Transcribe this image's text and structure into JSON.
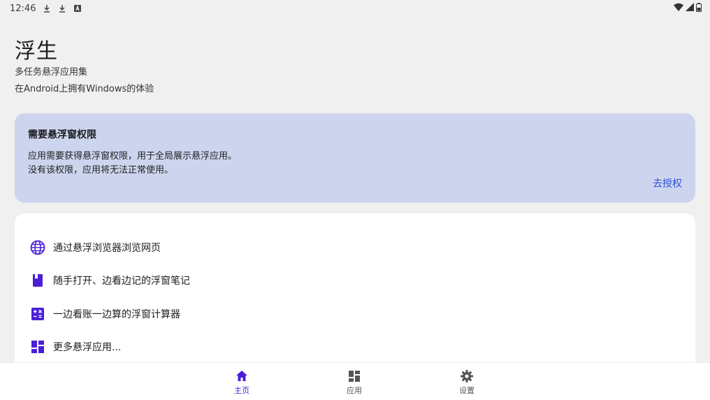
{
  "status_bar": {
    "time": "12:46"
  },
  "header": {
    "title": "浮生",
    "subtitle": "多任务悬浮应用集",
    "description": "在Android上拥有Windows的体验"
  },
  "permission_card": {
    "title": "需要悬浮窗权限",
    "body_line1": "应用需要获得悬浮窗权限，用于全局展示悬浮应用。",
    "body_line2": "没有该权限，应用将无法正常使用。",
    "action_label": "去授权"
  },
  "features": [
    {
      "label": "通过悬浮浏览器浏览网页",
      "icon": "globe-icon"
    },
    {
      "label": "随手打开、边看边记的浮窗笔记",
      "icon": "notebook-icon"
    },
    {
      "label": "一边看账一边算的浮窗计算器",
      "icon": "calculator-icon"
    },
    {
      "label": "更多悬浮应用...",
      "icon": "dashboard-icon"
    }
  ],
  "bottom_nav": [
    {
      "label": "主页",
      "icon": "home-icon",
      "active": true
    },
    {
      "label": "应用",
      "icon": "apps-grid-icon",
      "active": false
    },
    {
      "label": "设置",
      "icon": "gear-icon",
      "active": false
    }
  ],
  "colors": {
    "accent": "#4b1fd6",
    "link": "#2f52d6",
    "permission_card_bg": "#cdd5ee",
    "page_bg": "#f0f0f0"
  }
}
